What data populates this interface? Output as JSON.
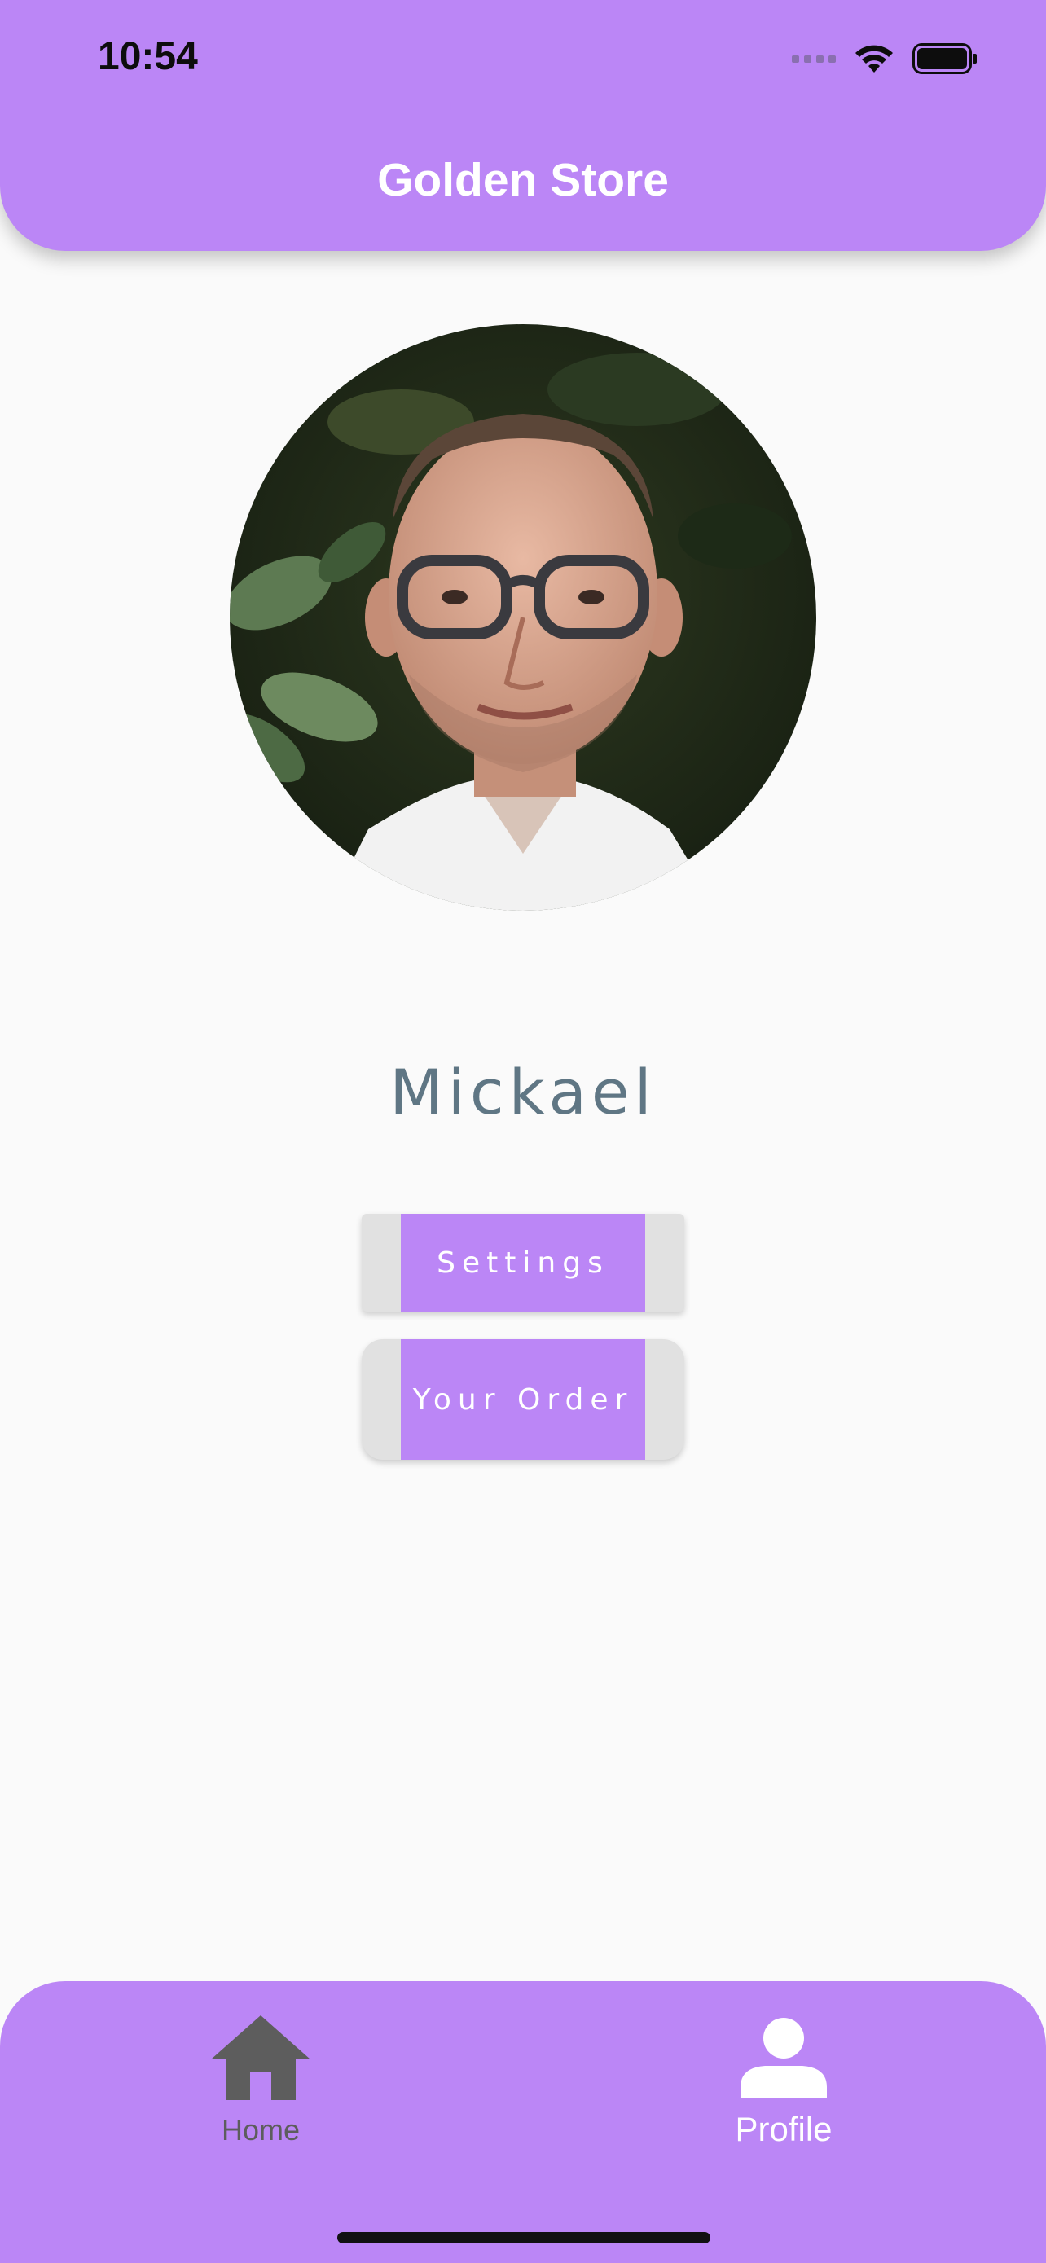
{
  "status_bar": {
    "time": "10:54"
  },
  "header": {
    "title": "Golden Store"
  },
  "profile": {
    "name": "Mickael"
  },
  "actions": {
    "settings_label": "Settings",
    "order_label": "Your Order"
  },
  "bottom_nav": {
    "items": [
      {
        "label": "Home",
        "icon": "home-icon",
        "active": false
      },
      {
        "label": "Profile",
        "icon": "person-icon",
        "active": true
      }
    ]
  },
  "colors": {
    "accent": "#bb86f6",
    "background": "#fafafa",
    "button_edge": "#e1e1e1",
    "name_text": "#5f7684",
    "inactive_nav": "#5d5d5d"
  }
}
